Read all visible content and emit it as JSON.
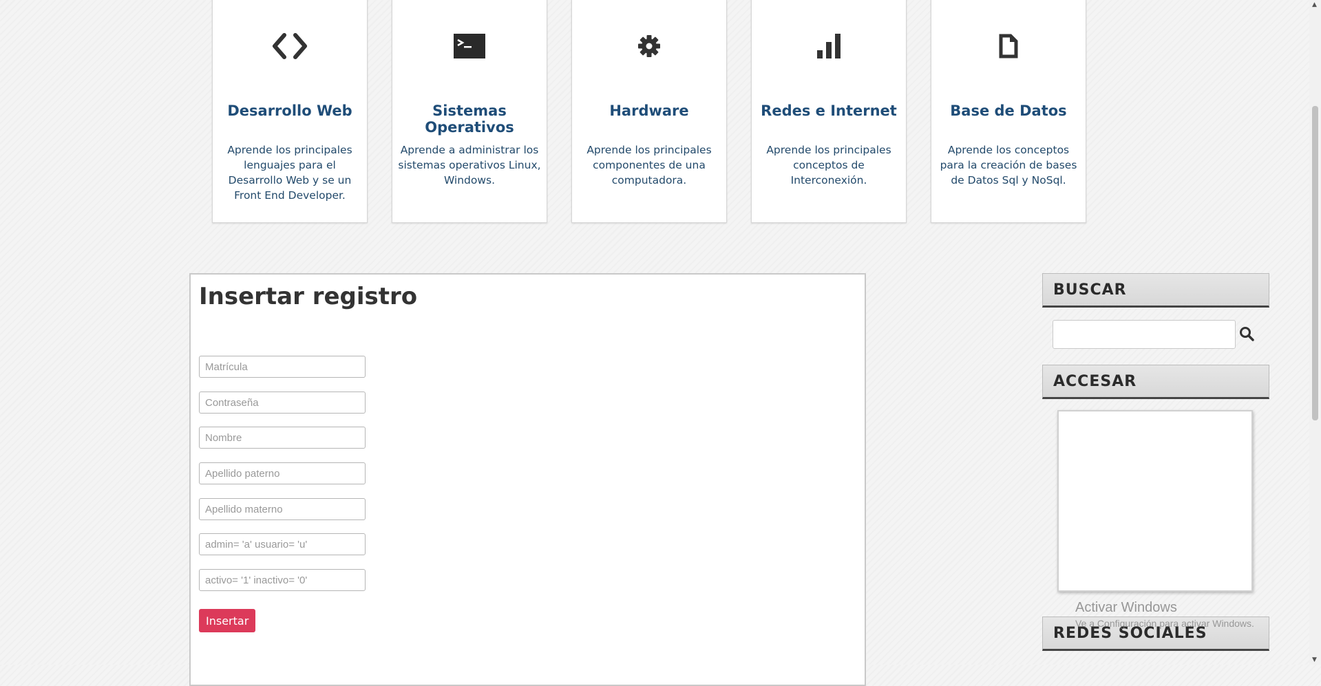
{
  "cards": [
    {
      "icon": "code-icon",
      "title": "Desarrollo Web",
      "desc": "Aprende los principales lenguajes para el Desarrollo Web y se un Front End Developer."
    },
    {
      "icon": "terminal-icon",
      "title": "Sistemas Operativos",
      "desc": "Aprende a administrar los sistemas operativos Linux, Windows."
    },
    {
      "icon": "gear-icon",
      "title": "Hardware",
      "desc": "Aprende los principales componentes de una computadora."
    },
    {
      "icon": "signal-bars-icon",
      "title": "Redes e Internet",
      "desc": "Aprende los principales conceptos de Interconexión."
    },
    {
      "icon": "file-icon",
      "title": "Base de Datos",
      "desc": "Aprende los conceptos para la creación de bases de Datos Sql y NoSql."
    }
  ],
  "form": {
    "title": "Insertar registro",
    "fields": [
      {
        "placeholder": "Matrícula",
        "value": ""
      },
      {
        "placeholder": "Contraseña",
        "value": ""
      },
      {
        "placeholder": "Nombre",
        "value": ""
      },
      {
        "placeholder": "Apellido paterno",
        "value": ""
      },
      {
        "placeholder": "Apellido materno",
        "value": ""
      },
      {
        "placeholder": "admin= 'a' usuario= 'u'",
        "value": ""
      },
      {
        "placeholder": "activo= '1' inactivo= '0'",
        "value": ""
      }
    ],
    "submit_label": "Insertar"
  },
  "sidebar": {
    "search_title": "BUSCAR",
    "search_placeholder": "",
    "search_icon": "search-icon",
    "access_title": "ACCESAR",
    "social_title": "REDES SOCIALES"
  },
  "watermark": {
    "line1": "Activar Windows",
    "line2": "Ve a Configuración para activar Windows."
  },
  "colors": {
    "card_title": "#1f4d78",
    "submit_button": "#dc3a5a",
    "widget_header_border": "#444444"
  }
}
